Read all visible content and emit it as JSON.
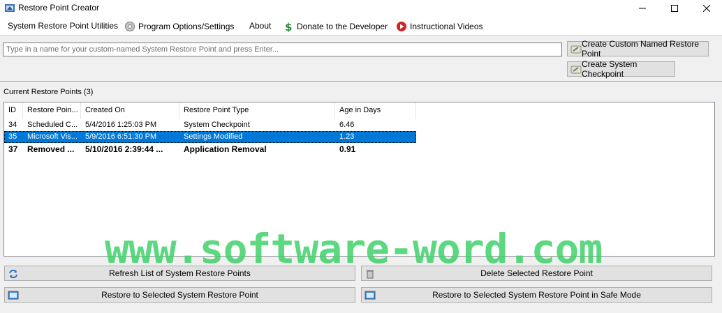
{
  "window": {
    "title": "Restore Point Creator",
    "minimize_glyph": "─",
    "maximize_glyph": "☐",
    "close_glyph": "✕"
  },
  "menu": [
    {
      "label": "System Restore Point Utilities",
      "icon": ""
    },
    {
      "label": "Program Options/Settings",
      "icon": "gear-icon"
    },
    {
      "label": "About",
      "icon": ""
    },
    {
      "label": "Donate to the Developer",
      "icon": "dollar-icon"
    },
    {
      "label": "Instructional Videos",
      "icon": "play-icon"
    }
  ],
  "create": {
    "input_placeholder": "Type in a name for your custom-named System Restore Point and press Enter...",
    "input_value": "",
    "custom_button": "Create Custom Named Restore Point",
    "checkpoint_button": "Create System Checkpoint"
  },
  "list": {
    "section_label": "Current Restore Points (3)",
    "columns": [
      "ID",
      "Restore Poin...",
      "Created On",
      "Restore Point Type",
      "Age in Days"
    ],
    "rows": [
      {
        "id": "34",
        "name": "Scheduled C...",
        "created": "5/4/2016 1:25:03 PM",
        "type": "System Checkpoint",
        "age": "6.46",
        "selected": false,
        "bold": false
      },
      {
        "id": "35",
        "name": "Microsoft Vis...",
        "created": "5/9/2016 6:51:30 PM",
        "type": "Settings Modified",
        "age": "1.23",
        "selected": true,
        "bold": false
      },
      {
        "id": "37",
        "name": "Removed ...",
        "created": "5/10/2016 2:39:44 ...",
        "type": "Application Removal",
        "age": "0.91",
        "selected": false,
        "bold": true
      }
    ]
  },
  "actions": {
    "refresh": "Refresh List of System Restore Points",
    "delete": "Delete Selected Restore Point",
    "restore": "Restore to Selected System Restore Point",
    "restore_safe": "Restore to Selected System Restore Point in Safe Mode"
  },
  "watermark": "www.software-word.com",
  "colors": {
    "selection": "#0078d7",
    "watermark": "#3fd26a"
  }
}
